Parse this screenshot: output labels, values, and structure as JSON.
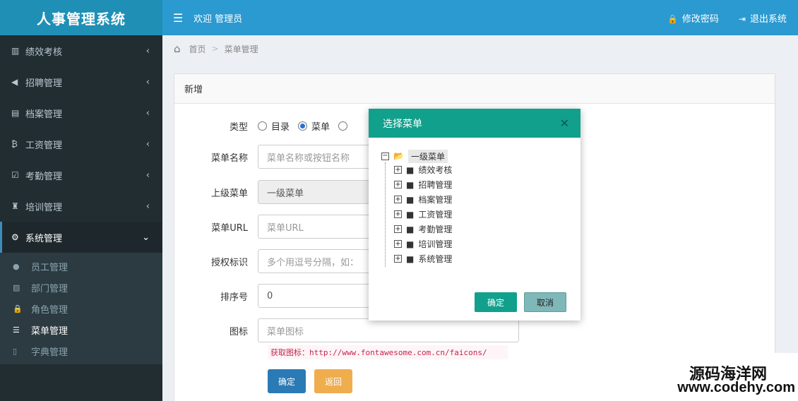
{
  "app": {
    "title": "人事管理系统"
  },
  "topbar": {
    "welcome": "欢迎 管理员",
    "change_password": "修改密码",
    "logout": "退出系统"
  },
  "sidebar": {
    "items": [
      {
        "label": "绩效考核",
        "icon": "bar-chart-icon"
      },
      {
        "label": "招聘管理",
        "icon": "bullhorn-icon"
      },
      {
        "label": "档案管理",
        "icon": "file-icon"
      },
      {
        "label": "工资管理",
        "icon": "bitcoin-icon"
      },
      {
        "label": "考勤管理",
        "icon": "calendar-check-icon"
      },
      {
        "label": "培训管理",
        "icon": "trophy-icon"
      },
      {
        "label": "系统管理",
        "icon": "gear-icon"
      }
    ],
    "subitems": [
      {
        "label": "员工管理",
        "icon": "user-icon"
      },
      {
        "label": "部门管理",
        "icon": "doc-icon"
      },
      {
        "label": "角色管理",
        "icon": "lock-icon"
      },
      {
        "label": "菜单管理",
        "icon": "list-icon"
      },
      {
        "label": "字典管理",
        "icon": "bookmark-icon"
      }
    ]
  },
  "breadcrumb": {
    "home": "首页",
    "current": "菜单管理"
  },
  "panel": {
    "title": "新增"
  },
  "form": {
    "type_label": "类型",
    "type_options": [
      "目录",
      "菜单"
    ],
    "name_label": "菜单名称",
    "name_placeholder": "菜单名称或按钮名称",
    "parent_label": "上级菜单",
    "parent_value": "一级菜单",
    "url_label": "菜单URL",
    "url_placeholder": "菜单URL",
    "perm_label": "授权标识",
    "perm_placeholder": "多个用逗号分隔，如：",
    "order_label": "排序号",
    "order_value": "0",
    "icon_label": "图标",
    "icon_placeholder": "菜单图标",
    "icon_hint": "获取图标：http://www.fontawesome.com.cn/faicons/",
    "submit": "确定",
    "back": "返回"
  },
  "modal": {
    "title": "选择菜单",
    "root": "一级菜单",
    "children": [
      "绩效考核",
      "招聘管理",
      "档案管理",
      "工资管理",
      "考勤管理",
      "培训管理",
      "系统管理"
    ],
    "ok": "确定",
    "cancel": "取消"
  },
  "watermark": {
    "line1": "源码海洋网",
    "line2": "www.codehy.com"
  }
}
